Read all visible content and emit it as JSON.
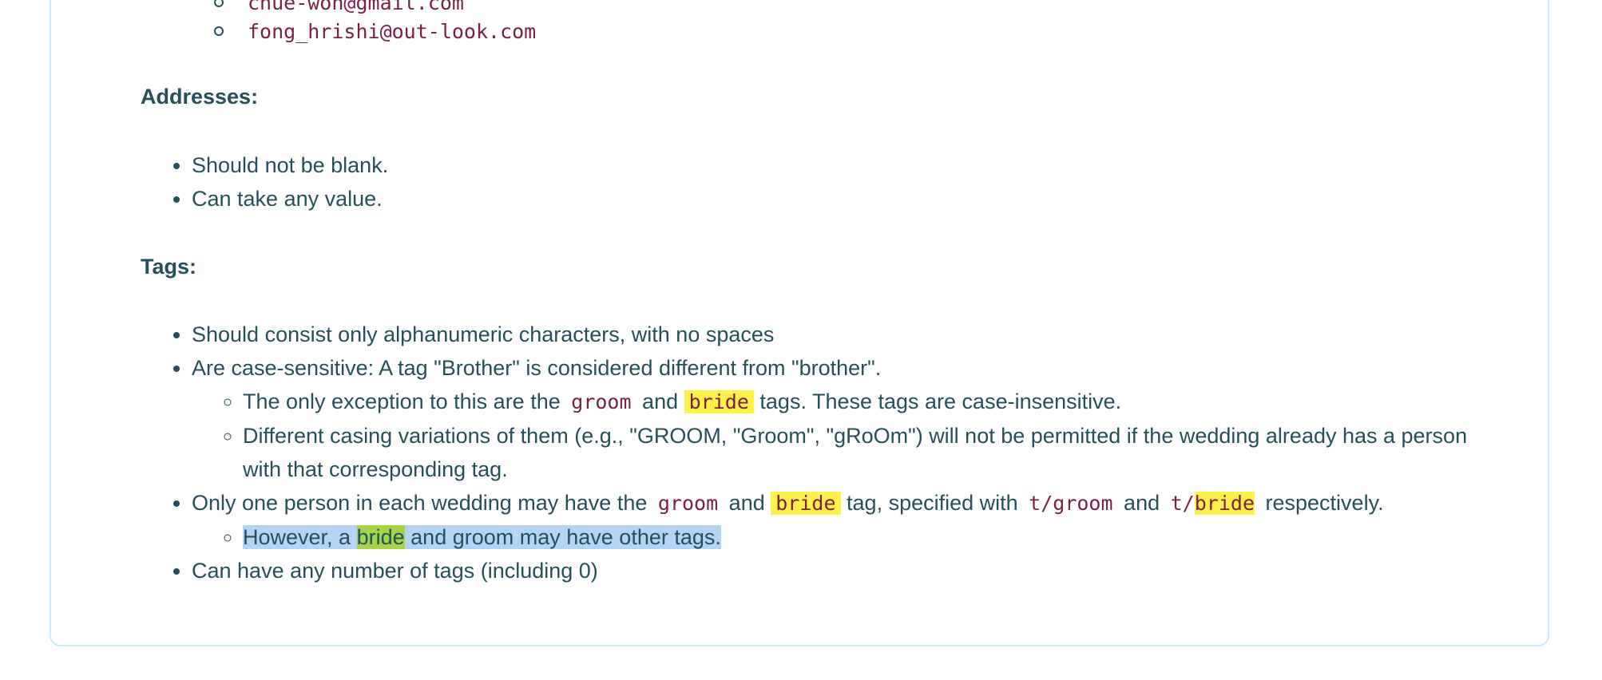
{
  "emails": [
    "chue-won@gmail.com",
    "fong_hrishi@out-look.com"
  ],
  "addresses": {
    "heading": "Addresses:",
    "items": [
      "Should not be blank.",
      "Can take any value."
    ]
  },
  "tags": {
    "heading": "Tags:",
    "item1": "Should consist only alphanumeric characters, with no spaces",
    "item2": "Are case-sensitive: A tag \"Brother\" is considered different from \"brother\".",
    "item2_sub1": {
      "pre": "The only exception to this are the",
      "code_groom": "groom",
      "and": "and",
      "code_bride": "bride",
      "post": "tags. These tags are case-insensitive."
    },
    "item2_sub2": "Different casing variations of them (e.g., \"GROOM, \"Groom\", \"gRoOm\") will not be permitted if the wedding already has a person with that corresponding tag.",
    "item3": {
      "pre": "Only one person in each wedding may have the",
      "code_groom": "groom",
      "and1": "and",
      "code_bride": "bride",
      "mid": "tag, specified with",
      "code_tgroom": "t/groom",
      "and2": "and",
      "code_tbride_prefix": "t/",
      "code_tbride_word": "bride",
      "post": "respectively."
    },
    "item3_sub1": {
      "pre": "However, a",
      "word_bride": "bride",
      "post": "and groom may have other tags."
    },
    "item4": "Can have any number of tags (including 0)"
  }
}
